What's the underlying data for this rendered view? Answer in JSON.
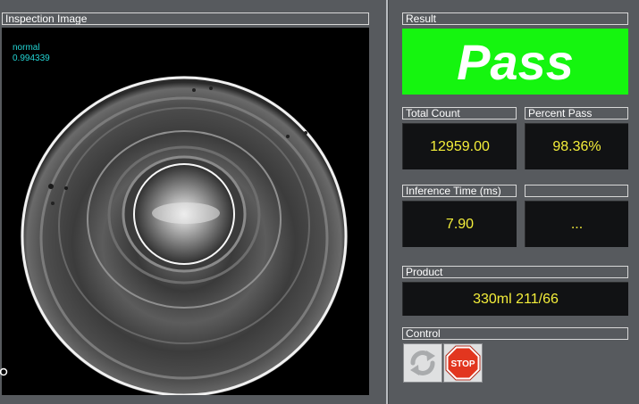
{
  "inspection": {
    "header": "Inspection Image",
    "label": "normal",
    "score": "0.994339"
  },
  "result": {
    "header": "Result",
    "value": "Pass",
    "color": "#15f50f"
  },
  "stats": {
    "total_count_header": "Total Count",
    "total_count_value": "12959.00",
    "percent_pass_header": "Percent Pass",
    "percent_pass_value": "98.36%",
    "inference_time_header": "Inference Time (ms)",
    "inference_time_value": "7.90",
    "extra_header": "",
    "extra_value": "..."
  },
  "product": {
    "header": "Product",
    "value": "330ml 211/66"
  },
  "control": {
    "header": "Control",
    "refresh_icon": "refresh-icon",
    "stop_icon": "stop-icon",
    "stop_label": "STOP"
  },
  "colors": {
    "value_text": "#f4ee3a",
    "overlay_text": "#23d4d4",
    "background": "#575a5e"
  }
}
